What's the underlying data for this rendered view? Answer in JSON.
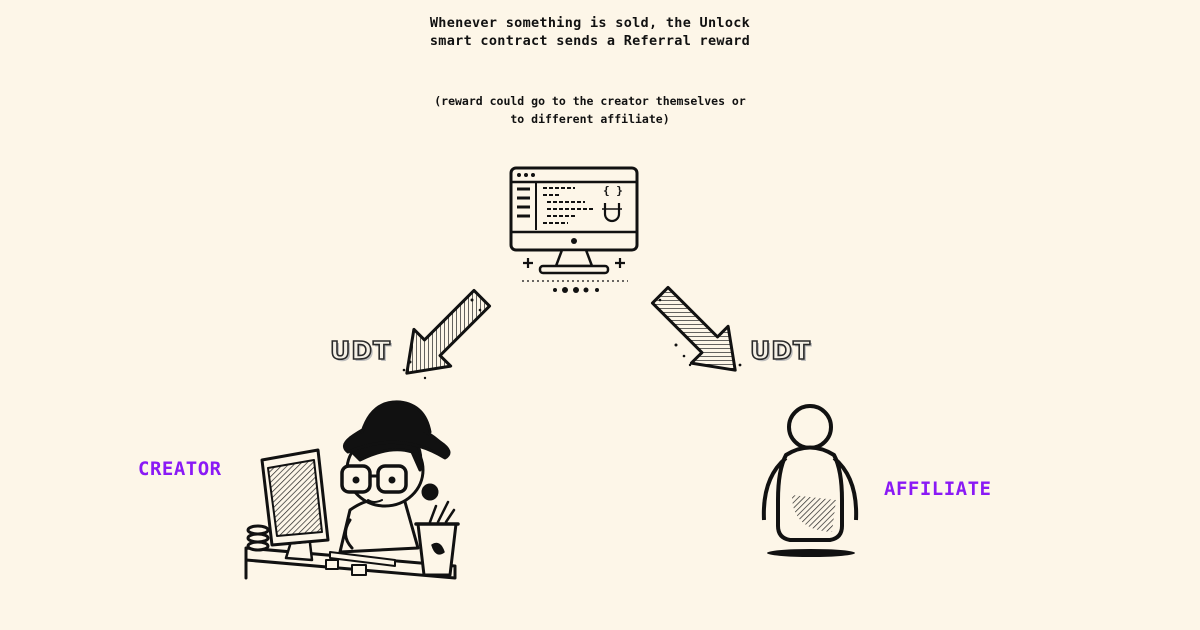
{
  "caption": {
    "main": "Whenever something is sold, the Unlock smart contract sends a Referral reward",
    "note": "(reward could go to the creator themselves or to different affiliate)"
  },
  "flow": {
    "token_left": "UDT",
    "token_right": "UDT"
  },
  "roles": {
    "creator": "CREATOR",
    "affiliate": "AFFILIATE"
  },
  "colors": {
    "background": "#fdf6e8",
    "label_purple": "#8a19f5",
    "ink": "#111111"
  },
  "icons": {
    "computer": "smart-contract-computer-icon",
    "arrow": "hatched-arrow-icon",
    "creator": "creator-at-desk-illustration",
    "affiliate": "person-icon"
  }
}
